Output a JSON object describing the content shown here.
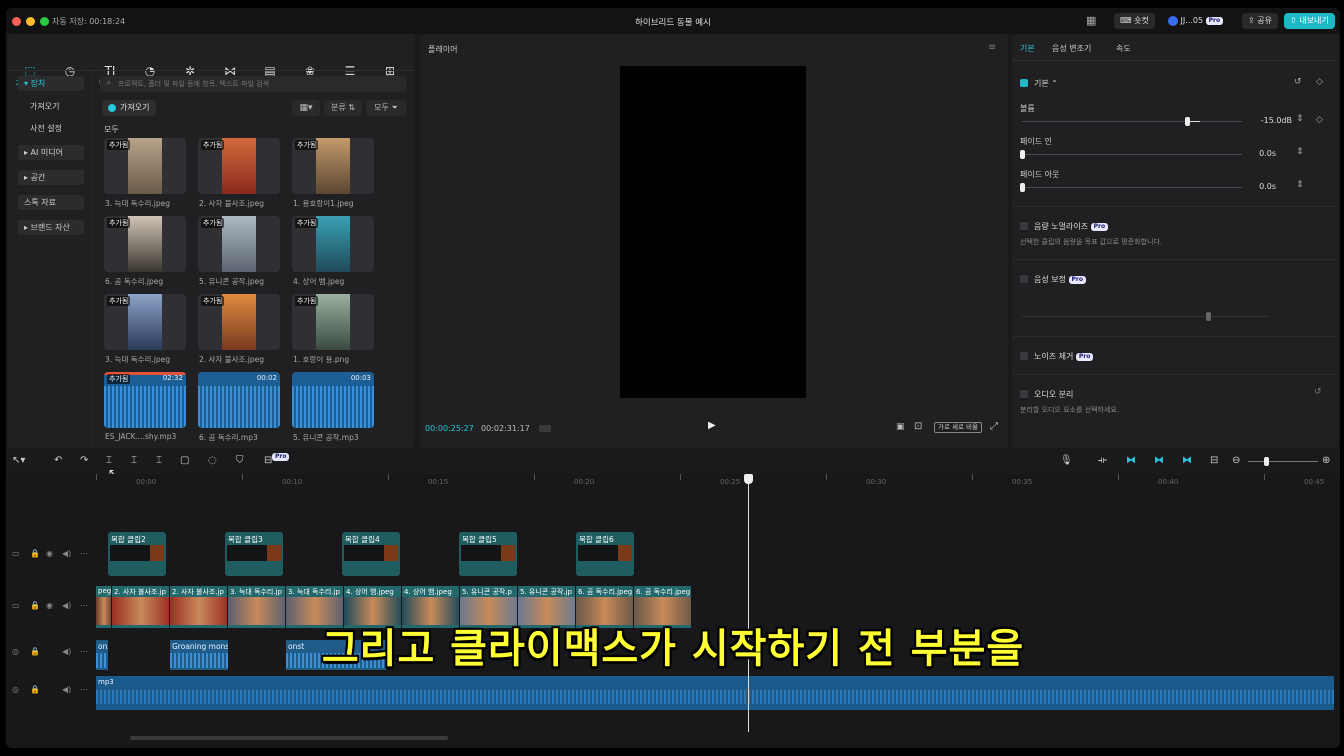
{
  "titlebar": {
    "autosave": "자동 저장: 00:18:24",
    "project_title": "하이브리드 동물 예시",
    "shortcut": "숏컷",
    "user": "JJ...05",
    "share": "공유",
    "export": "내보내기"
  },
  "toolbar": [
    {
      "label": "가져오기",
      "icon": "import-icon",
      "glyph": "⬚"
    },
    {
      "label": "오디오",
      "icon": "audio-icon",
      "glyph": "◷"
    },
    {
      "label": "텍스트",
      "icon": "text-icon",
      "glyph": "TI"
    },
    {
      "label": "스티커",
      "icon": "sticker-icon",
      "glyph": "◔"
    },
    {
      "label": "편집효과",
      "icon": "effects-icon",
      "glyph": "✲"
    },
    {
      "label": "전환",
      "icon": "transition-icon",
      "glyph": "⋈"
    },
    {
      "label": "캡션",
      "icon": "caption-icon",
      "glyph": "▤"
    },
    {
      "label": "필터",
      "icon": "filter-icon",
      "glyph": "❀"
    },
    {
      "label": "조정",
      "icon": "adjust-icon",
      "glyph": "☰"
    },
    {
      "label": "템플릿",
      "icon": "template-icon",
      "glyph": "⊞"
    }
  ],
  "sidebar": {
    "section_device": "▾ 장치",
    "items": [
      "가져오기",
      "사전 설정"
    ],
    "ai_media": "▸ AI 미디어",
    "space": "▸ 공간",
    "stock": "스톡 자료",
    "brand": "▸ 브랜드 자산"
  },
  "media": {
    "search_placeholder": "프로젝트, 폴더 및 파일 등에 항목, 텍스트 파일 검색",
    "import_button": "가져오기",
    "sort_label": "분류",
    "all_filter": "모두",
    "section_label": "모두",
    "items": [
      {
        "caption": "3. 늑대 독수리.jpeg",
        "tag": "추가됨",
        "duration": ""
      },
      {
        "caption": "2. 사자 불사조.jpeg",
        "tag": "추가됨",
        "duration": ""
      },
      {
        "caption": "1. 용호랑이1.jpeg",
        "tag": "추가됨",
        "duration": ""
      },
      {
        "caption": "6. 곰 독수리.jpeg",
        "tag": "추가됨",
        "duration": ""
      },
      {
        "caption": "5. 유니콘 공작.jpeg",
        "tag": "추가됨",
        "duration": ""
      },
      {
        "caption": "4. 상어 뱀.jpeg",
        "tag": "추가됨",
        "duration": ""
      },
      {
        "caption": "3. 늑대 독수리.jpeg",
        "tag": "추가됨",
        "duration": ""
      },
      {
        "caption": "2. 사자 불사조.jpeg",
        "tag": "추가됨",
        "duration": ""
      },
      {
        "caption": "1. 호랑이 용.png",
        "tag": "추가됨",
        "duration": ""
      },
      {
        "caption": "ES_JACK....shy.mp3",
        "tag": "추가됨",
        "duration": "02:32"
      },
      {
        "caption": "6. 곰 독수리.mp3",
        "tag": "",
        "duration": "00:02"
      },
      {
        "caption": "5. 유니콘 공작.mp3",
        "tag": "",
        "duration": "00:03"
      }
    ]
  },
  "player": {
    "title": "플레이어",
    "current_time": "00:00:25:27",
    "total_time": "00:02:31:17",
    "ratio_button": "가로 세로 비율"
  },
  "inspector": {
    "tabs": [
      "기본",
      "음성 변조기",
      "속도"
    ],
    "basic_section": "기본",
    "volume_label": "볼륨",
    "volume_value": "-15.0dB",
    "volume_level": 0.75,
    "fade_in_label": "페이드 인",
    "fade_in_value": "0.0s",
    "fade_out_label": "페이드 아웃",
    "fade_out_value": "0.0s",
    "normalize_label": "음량 노멀라이즈",
    "normalize_desc": "선택한 클립의 음량을 목표 값으로 평준화합니다.",
    "enhance_label": "음성 보정",
    "noise_label": "노이즈 제거",
    "separate_label": "오디오 분리",
    "separate_desc": "분리할 오디오 요소를 선택하세요.",
    "pro_badge": "Pro"
  },
  "timeline": {
    "ruler": [
      "00:00",
      "00:10",
      "00:15",
      "00:20",
      "00:25",
      "00:30",
      "00:35",
      "00:40",
      "00:45"
    ],
    "compound_clips": [
      "복합 클립2",
      "복합 클립3",
      "복합 클립4",
      "복합 클립5",
      "복합 클립6"
    ],
    "video_clips": [
      "peg",
      "2. 사자 불사조.jp",
      "2. 사자 불사조.jp",
      "3. 늑대 독수리.jp",
      "3. 늑대 독수리.jp",
      "4. 상어 뱀.jpeg",
      "4. 상어 뱀.jpeg",
      "5. 유니콘 공작.p",
      "5. 유니콘 공작.jp",
      "6. 곰 독수리.jpeg",
      "6. 곰 독수리.jpeg"
    ],
    "audio_clips": [
      "onst",
      "Groaning mons",
      "onst"
    ],
    "music_clip": "mp3"
  },
  "subtitle": "그리고 클라이맥스가 시작하기 전 부분을",
  "colors": {
    "accent": "#27c6d8",
    "subtitle": "#ffff33"
  }
}
